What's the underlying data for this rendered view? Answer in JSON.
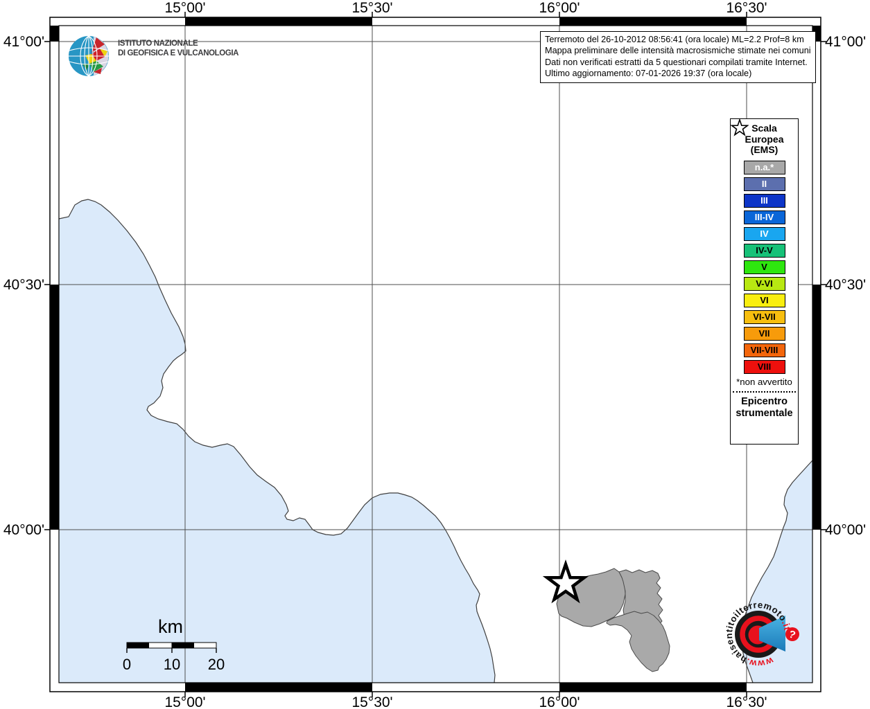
{
  "info_box": {
    "line1": "Terremoto del 26-10-2012 08:56:41 (ora locale) ML=2.2 Prof=8 km",
    "line2": "Mappa preliminare delle intensità macrosismiche stimate nei comuni",
    "line3": "Dati non verificati estratti da 5 questionari compilati tramite Internet.",
    "line4": "Ultimo aggiornamento: 07-01-2026 19:37 (ora locale)"
  },
  "axis": {
    "top": [
      "15°00'",
      "15°30'",
      "16°00'",
      "16°30'"
    ],
    "bottom": [
      "15°00'",
      "15°30'",
      "16°00'",
      "16°30'"
    ],
    "left": [
      "41°00'",
      "40°30'",
      "40°00'"
    ],
    "right": [
      "41°00'",
      "40°30'",
      "40°00'"
    ]
  },
  "ingv_logo": {
    "line1": "ISTITUTO NAZIONALE",
    "line2": "DI GEOFISICA E VULCANOLOGIA"
  },
  "legend": {
    "title_lines": [
      "Scala",
      "Europea",
      "(EMS)"
    ],
    "items": [
      {
        "label": "n.a.*",
        "color": "#a8a8a8",
        "text": "#ffffff"
      },
      {
        "label": "II",
        "color": "#5c6fae",
        "text": "#ffffff"
      },
      {
        "label": "III",
        "color": "#0d35c8",
        "text": "#ffffff"
      },
      {
        "label": "III-IV",
        "color": "#0a66d8",
        "text": "#ffffff"
      },
      {
        "label": "IV",
        "color": "#19a6f0",
        "text": "#ffffff"
      },
      {
        "label": "IV-V",
        "color": "#17c178",
        "text": "#000000"
      },
      {
        "label": "V",
        "color": "#2ee60f",
        "text": "#000000"
      },
      {
        "label": "V-VI",
        "color": "#b8e812",
        "text": "#000000"
      },
      {
        "label": "VI",
        "color": "#f9ee10",
        "text": "#000000"
      },
      {
        "label": "VI-VII",
        "color": "#f7be0f",
        "text": "#000000"
      },
      {
        "label": "VII",
        "color": "#f79b0b",
        "text": "#000000"
      },
      {
        "label": "VII-VIII",
        "color": "#f3660b",
        "text": "#000000"
      },
      {
        "label": "VIII",
        "color": "#ee100d",
        "text": "#000000"
      }
    ],
    "footnote": "*non avvertito",
    "epicenter_line1": "Epicentro",
    "epicenter_line2": "strumentale"
  },
  "scale_bar": {
    "unit": "km",
    "tick0": "0",
    "tick1": "10",
    "tick2": "20"
  },
  "site_logo": {
    "www": "www.",
    "name": "haisentitoilterremoto",
    "tld": ".it",
    "q": "?"
  },
  "colors": {
    "sea": "#dbeafa",
    "land": "#ffffff",
    "municipality": "#a9a9a9",
    "site_red": "#e8111d",
    "site_blue": "#2f9fd6",
    "site_black": "#1a1a1a"
  }
}
